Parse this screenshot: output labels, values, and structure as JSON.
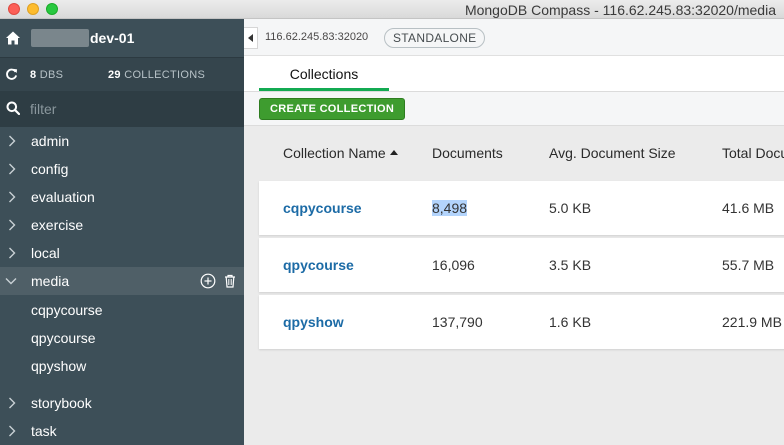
{
  "window": {
    "title": "MongoDB Compass - 116.62.245.83:32020/media"
  },
  "sidebar": {
    "host": "dev-01",
    "stats": {
      "dbs_count": "8",
      "dbs_label": "DBS",
      "collections_count": "29",
      "collections_label": "COLLECTIONS"
    },
    "filter_placeholder": "filter",
    "databases": [
      {
        "label": "admin"
      },
      {
        "label": "config"
      },
      {
        "label": "evaluation"
      },
      {
        "label": "exercise"
      },
      {
        "label": "local"
      },
      {
        "label": "media"
      },
      {
        "label": "storybook"
      },
      {
        "label": "task"
      }
    ],
    "media_collections": [
      {
        "label": "cqpycourse"
      },
      {
        "label": "qpycourse"
      },
      {
        "label": "qpyshow"
      }
    ]
  },
  "header": {
    "host": "116.62.245.83:32020",
    "badge": "STANDALONE"
  },
  "tabs": [
    {
      "label": "Collections"
    }
  ],
  "toolbar": {
    "create_label": "CREATE COLLECTION"
  },
  "table": {
    "columns": [
      "Collection Name",
      "Documents",
      "Avg. Document Size",
      "Total Docu"
    ],
    "rows": [
      {
        "name": "cqpycourse",
        "documents": "8,498",
        "avg_size": "5.0 KB",
        "total_size": "41.6 MB"
      },
      {
        "name": "qpycourse",
        "documents": "16,096",
        "avg_size": "3.5 KB",
        "total_size": "55.7 MB"
      },
      {
        "name": "qpyshow",
        "documents": "137,790",
        "avg_size": "1.6 KB",
        "total_size": "221.9 MB"
      }
    ]
  },
  "colors": {
    "sidebar_bg": "#3d4f58",
    "accent_green": "#13aa52",
    "button_green": "#3e9c2f",
    "link_blue": "#1c6ba6"
  },
  "icons": [
    "home-icon",
    "refresh-icon",
    "search-icon",
    "chevron-right-icon",
    "chevron-down-icon",
    "add-circle-icon",
    "trash-icon"
  ]
}
